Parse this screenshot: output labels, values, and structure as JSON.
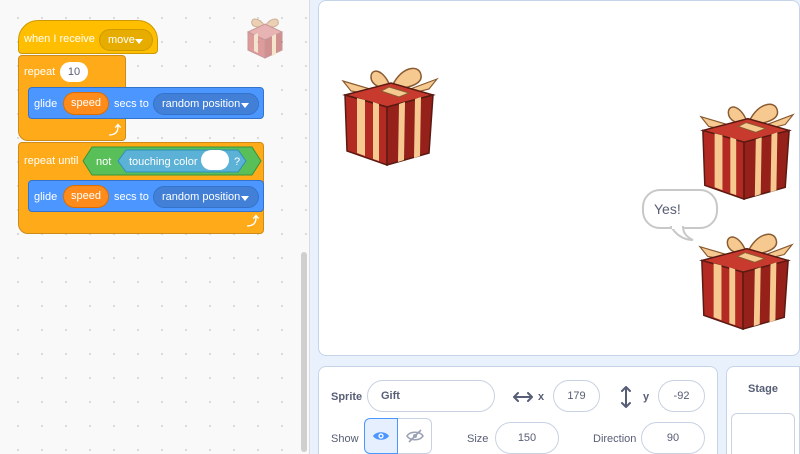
{
  "script": {
    "hat": {
      "label": "when I receive",
      "message": "move"
    },
    "repeat": {
      "label": "repeat",
      "times": "10"
    },
    "glide1": {
      "label": "glide",
      "variable": "speed",
      "secs_label": "secs to",
      "target": "random position"
    },
    "repeat_until": {
      "label": "repeat until",
      "not_label": "not",
      "sensing_label": "touching color",
      "q": "?"
    },
    "glide2": {
      "label": "glide",
      "variable": "speed",
      "secs_label": "secs to",
      "target": "random position"
    },
    "loop_icon": "loop-arrow-icon"
  },
  "stage": {
    "speech": "Yes!"
  },
  "sprite_info": {
    "sprite_label": "Sprite",
    "sprite_name": "Gift",
    "x_label": "x",
    "x_value": "179",
    "y_label": "y",
    "y_value": "-92",
    "show_label": "Show",
    "size_label": "Size",
    "size_value": "150",
    "direction_label": "Direction",
    "direction_value": "90"
  },
  "stage_panel": {
    "title": "Stage"
  },
  "colors": {
    "events": "#ffbf00",
    "control": "#ffab19",
    "motion": "#4c97ff",
    "operators": "#59c059",
    "sensing": "#5cb1d6",
    "variables": "#ff8c1a",
    "show_active": "#4c97ff"
  }
}
